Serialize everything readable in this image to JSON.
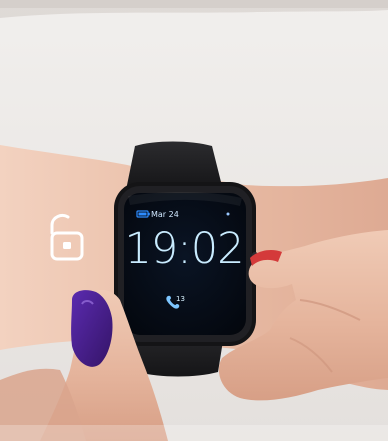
{
  "photo": {
    "description_icon": "unlock-icon",
    "overlay": {
      "unlock_icon": "unlocked-padlock-icon"
    },
    "watch": {
      "battery_icon": "battery-icon",
      "date_text": "Mar 24",
      "time_text": "19:02",
      "phone_icon": "phone-icon",
      "call_count": "13"
    },
    "colors": {
      "background": "#e9e6e3",
      "skin": "#e0b8a1",
      "nail_polish_left": "#4a1f8c",
      "nail_polish_right": "#d43a3a",
      "watch_body": "#1c1c1e",
      "watch_screen": "#05080f",
      "watch_accent": "#2d8cff",
      "watch_text": "#c9ecff"
    }
  }
}
